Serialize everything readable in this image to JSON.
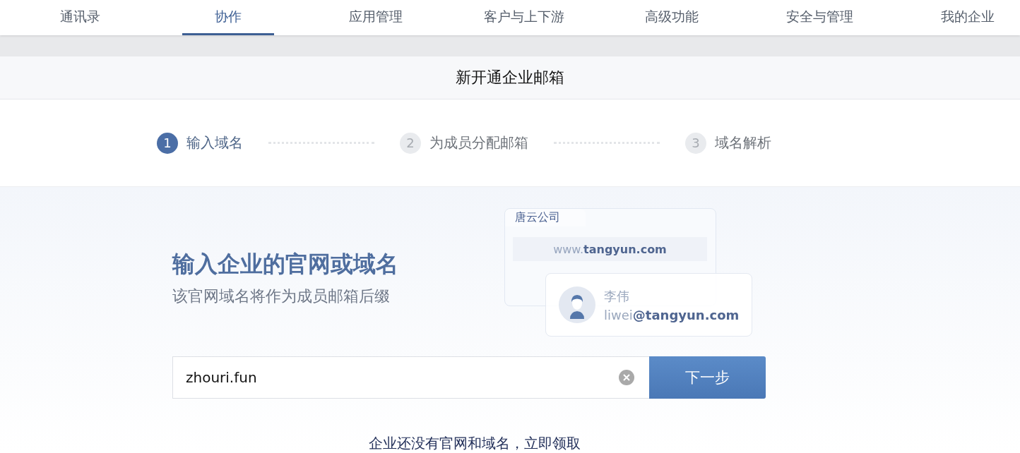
{
  "nav": {
    "tabs": [
      {
        "label": "通讯录",
        "selected": false
      },
      {
        "label": "协作",
        "selected": true
      },
      {
        "label": "应用管理",
        "selected": false
      },
      {
        "label": "客户与上下游",
        "selected": false
      },
      {
        "label": "高级功能",
        "selected": false
      },
      {
        "label": "安全与管理",
        "selected": false
      },
      {
        "label": "我的企业",
        "selected": false
      }
    ]
  },
  "page_title": "新开通企业邮箱",
  "steps": [
    {
      "number": "1",
      "label": "输入域名",
      "selected": true
    },
    {
      "number": "2",
      "label": "为成员分配邮箱",
      "selected": false
    },
    {
      "number": "3",
      "label": "域名解析",
      "selected": false
    }
  ],
  "hero": {
    "heading": "输入企业的官网或域名",
    "subheading": "该官网域名将作为成员邮箱后缀"
  },
  "illustration": {
    "company": "唐云公司",
    "url_prefix": "www.",
    "url_domain": "tangyun.com",
    "person_name": "李伟",
    "email_user": "liwei",
    "email_domain": "@tangyun.com"
  },
  "domain_field": {
    "value": "zhouri.fun"
  },
  "next_button": "下一步",
  "footer_link": "企业还没有官网和域名，立即领取"
}
